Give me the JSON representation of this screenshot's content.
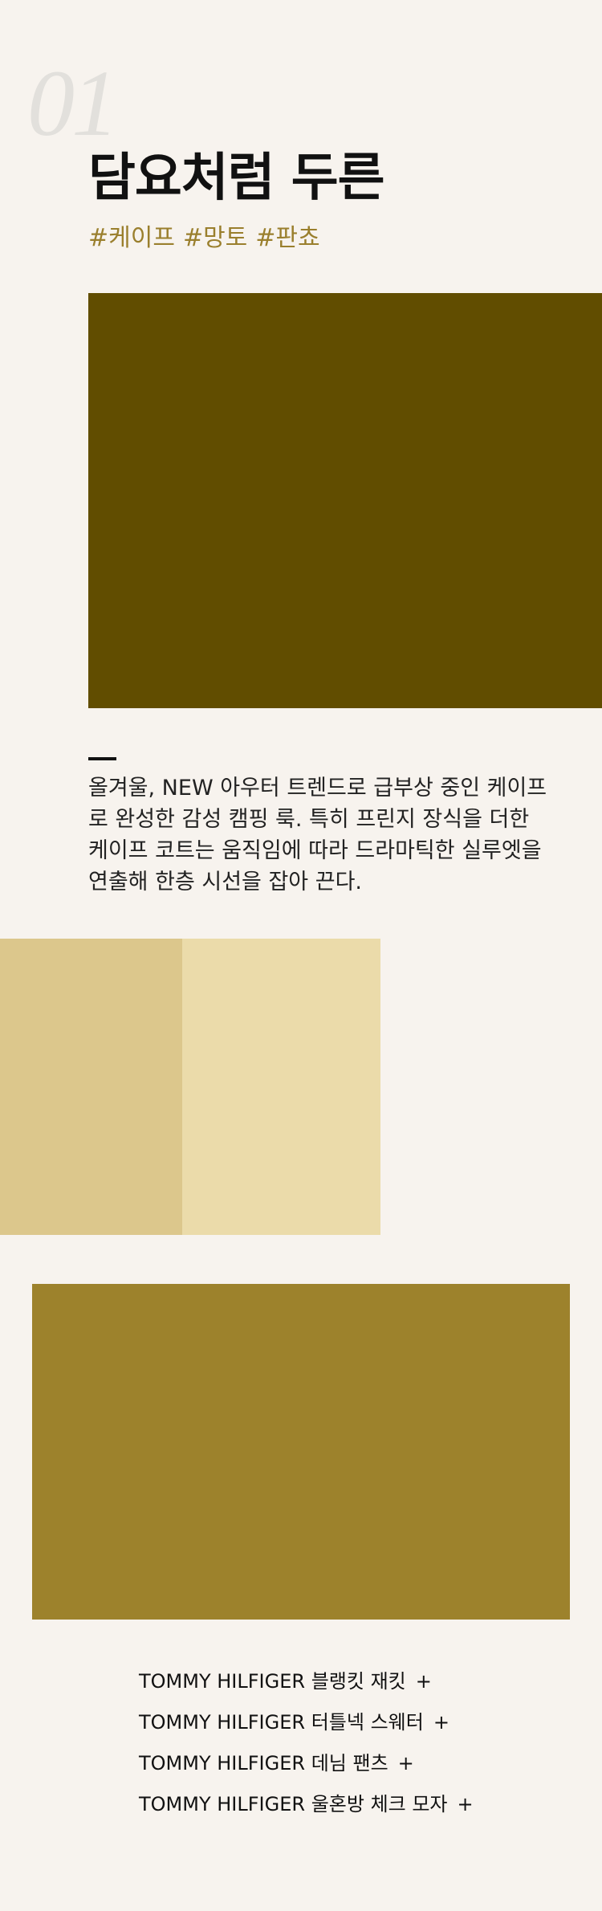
{
  "section": {
    "number": "01",
    "title": "담요처럼 두른",
    "tags": [
      "#케이프",
      "#망토",
      "#판쵸"
    ]
  },
  "description": {
    "text": "올겨울, NEW 아우터 트렌드로 급부상 중인 케이프로 완성한 감성 캠핑 룩. 특히 프린지 장식을 더한 케이프 코트는 움직임에 따라 드라마틱한 실루엣을 연출해 한층 시선을 잡아 끈다."
  },
  "products": [
    {
      "label": "TOMMY HILFIGER 블랭킷 재킷",
      "plus_icon": "plus-icon",
      "plus_symbol": "+"
    },
    {
      "label": "TOMMY HILFIGER 터틀넥 스웨터",
      "plus_icon": "plus-icon",
      "plus_symbol": "+"
    },
    {
      "label": "TOMMY HILFIGER 데님 팬츠",
      "plus_icon": "plus-icon",
      "plus_symbol": "+"
    },
    {
      "label": "TOMMY HILFIGER 울혼방 체크 모자",
      "plus_icon": "plus-icon",
      "plus_symbol": "+"
    }
  ],
  "colors": {
    "background": "#f7f3ee",
    "section_number": "#e2e0dc",
    "accent_tag": "#9a7f2d",
    "hero_image": "#614d00",
    "rule": "#111111",
    "swatch_left": "#dcc78c",
    "swatch_right": "#ebdbaa",
    "bottom_image": "#9d822c"
  }
}
